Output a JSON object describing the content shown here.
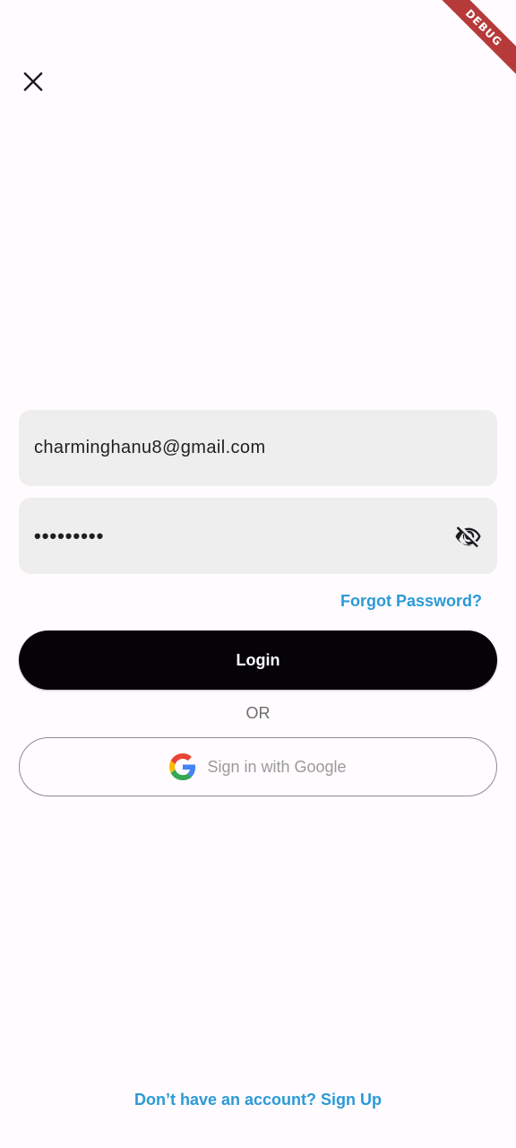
{
  "debug_banner": {
    "label": "DEBUG"
  },
  "login_form": {
    "email_value": "charminghanu8@gmail.com",
    "password_masked": "•••••••••",
    "forgot_password_label": "Forgot Password?",
    "login_label": "Login",
    "or_label": "OR",
    "google_label": "Sign in with Google",
    "signup_label": "Don’t have an account? Sign Up"
  },
  "icons": {
    "close": "close-icon",
    "password_visibility": "visibility-off-icon",
    "google": "google-logo-icon"
  },
  "colors": {
    "background": "#fffbfe",
    "field_background": "#eeeeee",
    "login_button": "#050208",
    "link": "#2b9ad6",
    "debug_ribbon": "#b63a3a"
  }
}
